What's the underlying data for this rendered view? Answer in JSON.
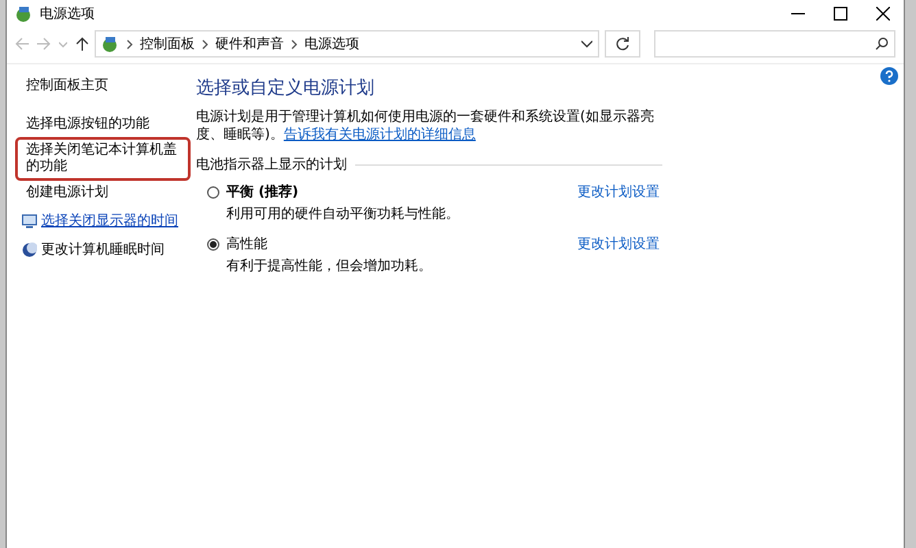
{
  "window": {
    "title": "电源选项"
  },
  "address_bar": {
    "path": [
      "控制面板",
      "硬件和声音",
      "电源选项"
    ]
  },
  "sidebar": {
    "items": [
      {
        "label": "控制面板主页",
        "kind": "plain",
        "highlighted": false
      },
      {
        "label": "选择电源按钮的功能",
        "kind": "plain",
        "highlighted": false
      },
      {
        "label": "选择关闭笔记本计算机盖的功能",
        "kind": "plain",
        "highlighted": true
      },
      {
        "label": "创建电源计划",
        "kind": "plain",
        "highlighted": false
      },
      {
        "label": "选择关闭显示器的时间",
        "kind": "monitor",
        "highlighted": false
      },
      {
        "label": "更改计算机睡眠时间",
        "kind": "moon",
        "highlighted": false
      }
    ]
  },
  "main": {
    "heading": "选择或自定义电源计划",
    "description": "电源计划是用于管理计算机如何使用电源的一套硬件和系统设置(如显示器亮度、睡眠等)。",
    "description_link": "告诉我有关电源计划的详细信息",
    "group_label": "电池指示器上显示的计划",
    "plans": [
      {
        "name": "平衡 (推荐)",
        "description": "利用可用的硬件自动平衡功耗与性能。",
        "link": "更改计划设置",
        "selected": false
      },
      {
        "name": "高性能",
        "description": "有利于提高性能，但会增加功耗。",
        "link": "更改计划设置",
        "selected": true
      }
    ]
  }
}
